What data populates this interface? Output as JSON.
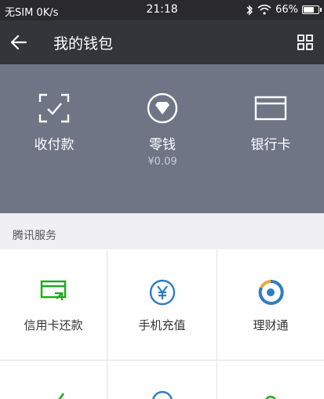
{
  "status_bar": {
    "carrier": "无SIM 0K/s",
    "time": "21:18",
    "battery": "66%",
    "battery_level": 0.66
  },
  "title_bar": {
    "title": "我的钱包",
    "back_icon": "back-arrow-icon",
    "more_icon": "grid-menu-icon"
  },
  "wallet": {
    "items": [
      {
        "label": "收付款",
        "icon": "scan-pay-icon"
      },
      {
        "label": "零钱",
        "sub": "¥0.09",
        "icon": "change-icon"
      },
      {
        "label": "银行卡",
        "icon": "bank-card-icon"
      }
    ],
    "colors": {
      "header_bg": "#6f7585"
    }
  },
  "services": {
    "section_title": "腾讯服务",
    "items": [
      {
        "label": "信用卡还款",
        "icon": "credit-card-repay-icon"
      },
      {
        "label": "手机充值",
        "icon": "phone-recharge-icon"
      },
      {
        "label": "理财通",
        "icon": "wealth-icon"
      },
      {
        "label": "",
        "icon": "check-icon"
      },
      {
        "label": "",
        "icon": "circle-icon"
      },
      {
        "label": "",
        "icon": "leaf-icon"
      }
    ],
    "colors": {
      "green": "#1aad19",
      "blue": "#2f7cc6"
    }
  }
}
